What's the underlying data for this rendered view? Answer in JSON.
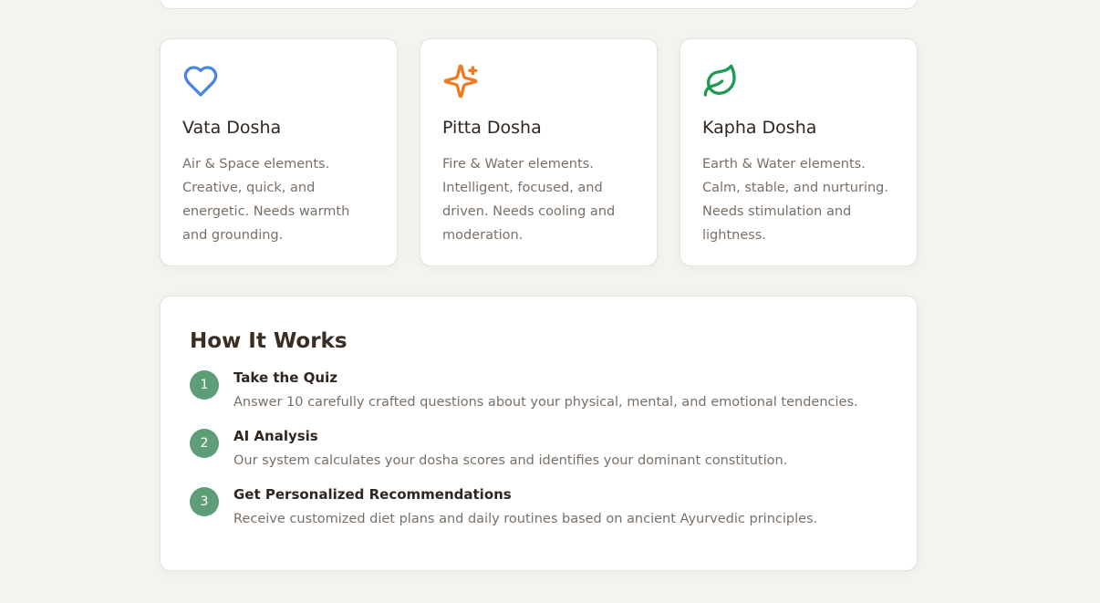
{
  "doshas": [
    {
      "icon": "heart-icon",
      "icon_color": "#4a86e0",
      "title": "Vata Dosha",
      "description": "Air & Space elements. Creative, quick, and energetic. Needs warmth and grounding."
    },
    {
      "icon": "sparkles-icon",
      "icon_color": "#ef7a1f",
      "title": "Pitta Dosha",
      "description": "Fire & Water elements. Intelligent, focused, and driven. Needs cooling and moderation."
    },
    {
      "icon": "leaf-icon",
      "icon_color": "#1f9a52",
      "title": "Kapha Dosha",
      "description": "Earth & Water elements. Calm, stable, and nurturing. Needs stimulation and lightness."
    }
  ],
  "how_it_works": {
    "title": "How It Works",
    "steps": [
      {
        "number": "1",
        "title": "Take the Quiz",
        "description": "Answer 10 carefully crafted questions about your physical, mental, and emotional tendencies."
      },
      {
        "number": "2",
        "title": "AI Analysis",
        "description": "Our system calculates your dosha scores and identifies your dominant constitution."
      },
      {
        "number": "3",
        "title": "Get Personalized Recommendations",
        "description": "Receive customized diet plans and daily routines based on ancient Ayurvedic principles."
      }
    ]
  },
  "colors": {
    "background": "#f5f3ef",
    "step_badge": "#5e9e76"
  }
}
